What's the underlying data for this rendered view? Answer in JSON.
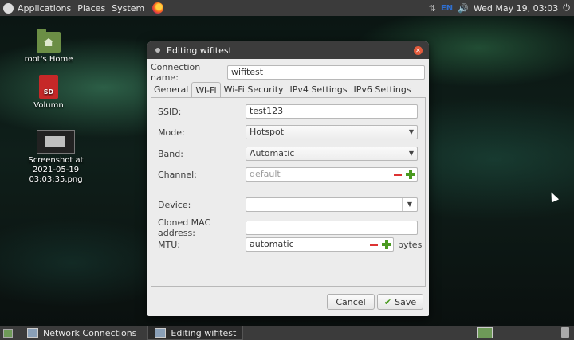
{
  "top_panel": {
    "menus": [
      "Applications",
      "Places",
      "System"
    ],
    "keyboard": "EN",
    "datetime": "Wed May 19, 03:03"
  },
  "desktop_icons": [
    {
      "label": "root's Home",
      "icon": "home-folder-icon"
    },
    {
      "label": "Volumn",
      "icon": "sd-card-icon"
    },
    {
      "label": "Screenshot at 2021-05-19 03:03:35.png",
      "icon": "image-file-icon"
    }
  ],
  "dialog": {
    "title": "Editing wifitest",
    "connection_name_label": "Connection name:",
    "connection_name_value": "wifitest",
    "tabs": [
      "General",
      "Wi-Fi",
      "Wi-Fi Security",
      "IPv4 Settings",
      "IPv6 Settings"
    ],
    "active_tab": "Wi-Fi",
    "wifi": {
      "ssid_label": "SSID:",
      "ssid_value": "test123",
      "mode_label": "Mode:",
      "mode_value": "Hotspot",
      "band_label": "Band:",
      "band_value": "Automatic",
      "channel_label": "Channel:",
      "channel_value": "default",
      "device_label": "Device:",
      "device_value": "",
      "mac_label": "Cloned MAC address:",
      "mac_value": "",
      "mtu_label": "MTU:",
      "mtu_value": "automatic",
      "mtu_unit": "bytes"
    },
    "cancel_label": "Cancel",
    "save_label": "Save"
  },
  "taskbar": {
    "tasks": [
      "Network Connections",
      "Editing wifitest"
    ],
    "active_task": "Editing wifitest"
  },
  "colors": {
    "panel": "#3b3b3b",
    "dialog_bg": "#ececec",
    "close": "#e35b3c",
    "plus": "#4a9a20",
    "minus": "#dd3333"
  }
}
